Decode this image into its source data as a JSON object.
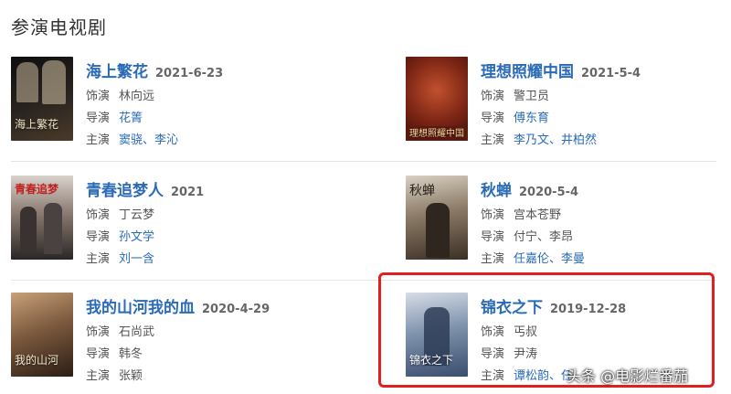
{
  "section_title": "参演电视剧",
  "labels": {
    "actor": "饰演",
    "director": "导演",
    "cast": "主演"
  },
  "shows": [
    {
      "title": "海上繁花",
      "date": "2021-6-23",
      "role": "林向远",
      "director": "花箐",
      "cast": [
        "窦骁",
        "李沁"
      ],
      "poster_text": "海上繁花",
      "poster_colors": [
        "#1b1b1b",
        "#4a3b2a"
      ]
    },
    {
      "title": "理想照耀中国",
      "date": "2021-5-4",
      "role": "警卫员",
      "director": "傅东育",
      "cast": [
        "李乃文",
        "井柏然"
      ],
      "poster_text": "理想照耀中国",
      "poster_colors": [
        "#3a0f0a",
        "#a8341d"
      ]
    },
    {
      "title": "青春追梦人",
      "date": "2021",
      "role": "丁云梦",
      "director": "孙文学",
      "cast": [
        "刘一含"
      ],
      "poster_text": "青春追梦",
      "poster_colors": [
        "#2a2626",
        "#6b5a52"
      ]
    },
    {
      "title": "秋蝉",
      "date": "2020-5-4",
      "role": "宫本苍野",
      "director": "付宁、李昂",
      "cast": [
        "任嘉伦",
        "李曼"
      ],
      "poster_text": "秋蝉",
      "poster_colors": [
        "#3b2f25",
        "#8b7a66"
      ]
    },
    {
      "title": "我的山河我的血",
      "date": "2020-4-29",
      "role": "石尚武",
      "director": "韩冬",
      "cast": [
        "张颖"
      ],
      "poster_text": "我的山河",
      "poster_colors": [
        "#2b1d15",
        "#7c5a3e"
      ]
    },
    {
      "title": "锦衣之下",
      "date": "2019-12-28",
      "role": "丐叔",
      "director": "尹涛",
      "cast": [
        "谭松韵",
        "任"
      ],
      "poster_text": "锦衣之下",
      "poster_colors": [
        "#3a4e6e",
        "#b9c3cf"
      ]
    }
  ],
  "watermark": "头条 @电影烂番茄"
}
